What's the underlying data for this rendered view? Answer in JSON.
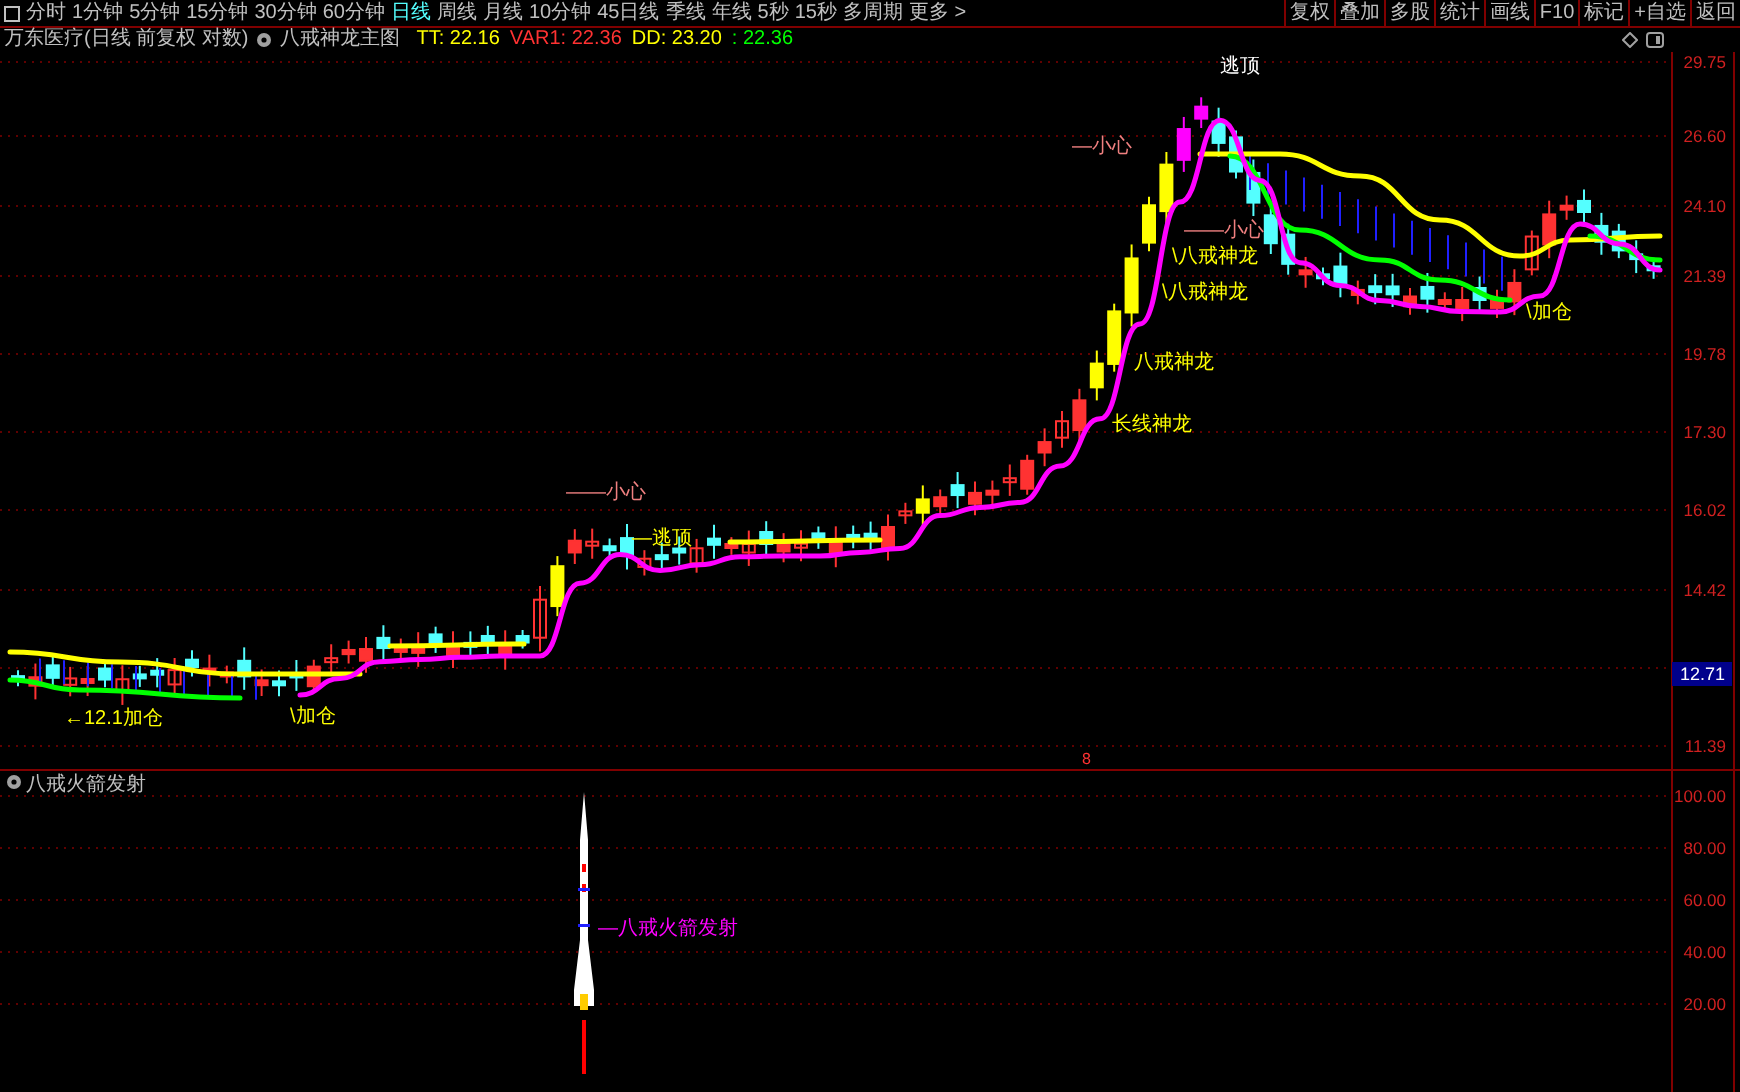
{
  "toolbar": {
    "period_tabs": [
      {
        "label": "分时",
        "selected": false
      },
      {
        "label": "1分钟",
        "selected": false
      },
      {
        "label": "5分钟",
        "selected": false
      },
      {
        "label": "15分钟",
        "selected": false
      },
      {
        "label": "30分钟",
        "selected": false
      },
      {
        "label": "60分钟",
        "selected": false
      },
      {
        "label": "日线",
        "selected": true
      },
      {
        "label": "周线",
        "selected": false
      },
      {
        "label": "月线",
        "selected": false
      },
      {
        "label": "10分钟",
        "selected": false
      },
      {
        "label": "45日线",
        "selected": false
      },
      {
        "label": "季线",
        "selected": false
      },
      {
        "label": "年线",
        "selected": false
      },
      {
        "label": "5秒",
        "selected": false
      },
      {
        "label": "15秒",
        "selected": false
      },
      {
        "label": "多周期",
        "selected": false
      },
      {
        "label": "更多 >",
        "selected": false
      }
    ],
    "buttons": [
      "复权",
      "叠加",
      "多股",
      "统计",
      "画线",
      "F10",
      "标记",
      "+自选",
      "返回"
    ]
  },
  "chart_header": {
    "title": "万东医疗(日线 前复权 对数)",
    "indicator": "八戒神龙主图",
    "values": [
      {
        "text": "TT: 22.16",
        "color": "#ffff00"
      },
      {
        "text": "VAR1: 22.36",
        "color": "#ff3232"
      },
      {
        "text": "DD: 23.20",
        "color": "#ffff00"
      },
      {
        "text": ": 22.36",
        "color": "#00ff00"
      }
    ]
  },
  "price_axis": {
    "labels": [
      "29.75",
      "26.60",
      "24.10",
      "21.39",
      "19.78",
      "17.30",
      "16.02",
      "14.42",
      "11.39"
    ],
    "current_price": "12.71"
  },
  "annotations": [
    {
      "text": "逃顶",
      "color": "#ffffff"
    },
    {
      "text": "—小心",
      "color": "#f08080"
    },
    {
      "text": "——小心",
      "color": "#f08080"
    },
    {
      "text": "\\八戒神龙",
      "color": "#ffff00"
    },
    {
      "text": "\\八戒神龙",
      "color": "#ffff00"
    },
    {
      "text": "八戒神龙",
      "color": "#ffff00"
    },
    {
      "text": "长线神龙",
      "color": "#ffff00"
    },
    {
      "text": "\\加仓",
      "color": "#ffff00"
    },
    {
      "text": "——小心",
      "color": "#f08080"
    },
    {
      "text": "—逃顶",
      "color": "#ffff00"
    },
    {
      "text": "←12.1加仓",
      "color": "#ffff00"
    },
    {
      "text": "\\加仓",
      "color": "#ffff00"
    }
  ],
  "marker": "8",
  "sub_chart": {
    "title": "八戒火箭发射",
    "signal_label": "—八戒火箭发射",
    "axis_labels": [
      "100.00",
      "80.00",
      "60.00",
      "40.00",
      "20.00"
    ]
  }
}
